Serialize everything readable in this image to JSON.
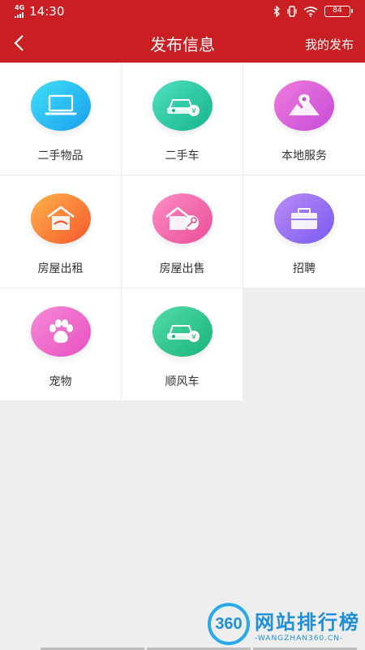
{
  "status_bar": {
    "network": "4G",
    "time": "14:30",
    "battery": "84"
  },
  "nav": {
    "title": "发布信息",
    "right_action": "我的发布"
  },
  "categories": [
    {
      "label": "二手物品",
      "icon": "laptop-icon",
      "color_start": "#3fe0f5",
      "color_end": "#1a9ff0"
    },
    {
      "label": "二手车",
      "icon": "car-icon",
      "color_start": "#4fe0c0",
      "color_end": "#16b58d"
    },
    {
      "label": "本地服务",
      "icon": "map-pin-icon",
      "color_start": "#f07bdc",
      "color_end": "#c64bd8"
    },
    {
      "label": "房屋出租",
      "icon": "house-rent-icon",
      "color_start": "#ffb24a",
      "color_end": "#f5582e"
    },
    {
      "label": "房屋出售",
      "icon": "house-key-icon",
      "color_start": "#fb8dc6",
      "color_end": "#ec4d96"
    },
    {
      "label": "招聘",
      "icon": "briefcase-icon",
      "color_start": "#b98cf7",
      "color_end": "#7a5af0"
    },
    {
      "label": "宠物",
      "icon": "paw-icon",
      "color_start": "#f58bd6",
      "color_end": "#e94fc2"
    },
    {
      "label": "顺风车",
      "icon": "car-icon",
      "color_start": "#52dca8",
      "color_end": "#1ab37a"
    }
  ],
  "watermark": {
    "logo_text": "360",
    "title": "网站排行榜",
    "subtitle": "-WANGZHAN360.CN-"
  }
}
